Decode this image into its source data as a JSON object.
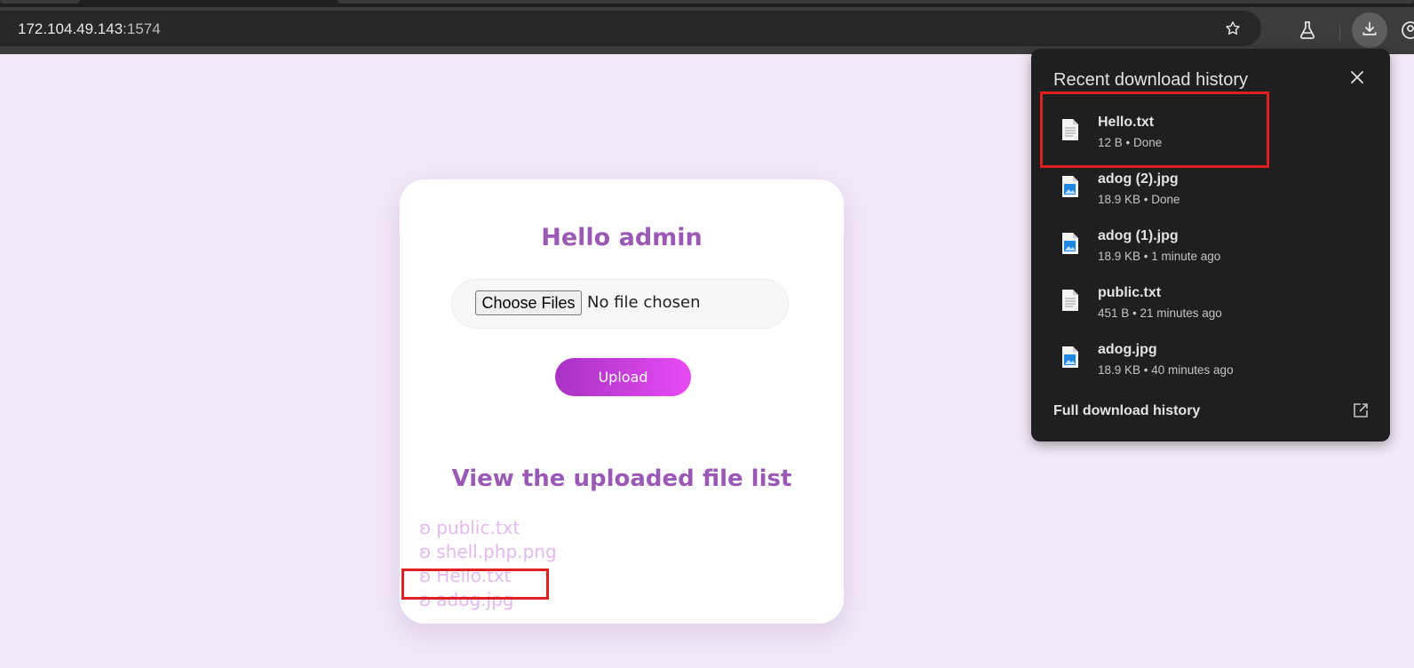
{
  "browser": {
    "url_host": "172.104.49.143",
    "url_port": ":1574"
  },
  "page": {
    "greeting": "Hello admin",
    "file_input": {
      "button_label": "Choose Files",
      "status": "No file chosen"
    },
    "upload_label": "Upload",
    "list_heading": "View the uploaded file list",
    "files": [
      {
        "bullet": "ʚ",
        "name": "public.txt"
      },
      {
        "bullet": "ʚ",
        "name": "shell.php.png"
      },
      {
        "bullet": "ʚ",
        "name": "Hello.txt"
      },
      {
        "bullet": "ʚ",
        "name": "adog.jpg"
      }
    ],
    "colors": {
      "background": "#f3e8f8",
      "heading": "#9b59b6",
      "link": "#e3b9ee",
      "button_from": "#a832c4",
      "button_to": "#e84af5"
    }
  },
  "downloads": {
    "title": "Recent download history",
    "items": [
      {
        "name": "Hello.txt",
        "meta": "12 B • Done",
        "icon": "text-file-icon"
      },
      {
        "name": "adog (2).jpg",
        "meta": "18.9 KB • Done",
        "icon": "image-file-icon"
      },
      {
        "name": "adog (1).jpg",
        "meta": "18.9 KB • 1 minute ago",
        "icon": "image-file-icon"
      },
      {
        "name": "public.txt",
        "meta": "451 B • 21 minutes ago",
        "icon": "text-file-icon"
      },
      {
        "name": "adog.jpg",
        "meta": "18.9 KB • 40 minutes ago",
        "icon": "image-file-icon"
      }
    ],
    "footer": "Full download history"
  },
  "annotations": {
    "highlight_color": "#e02020"
  }
}
